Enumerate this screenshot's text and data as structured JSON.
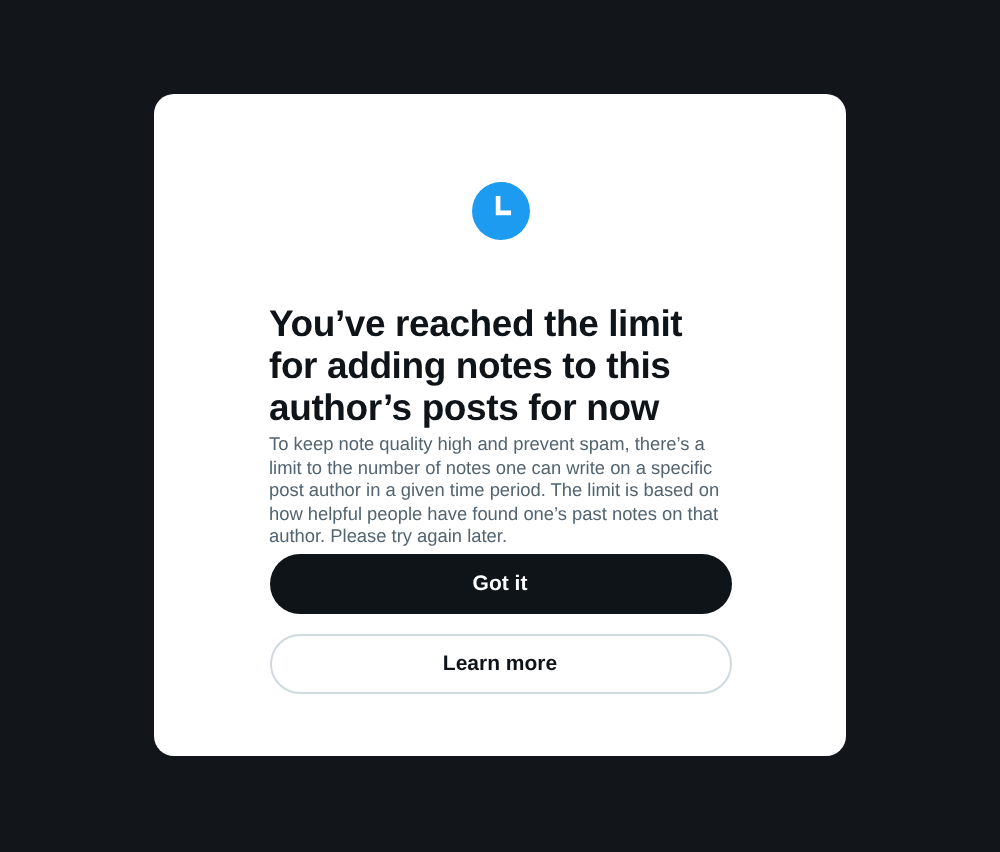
{
  "dialog": {
    "title": "You’ve reached the limit for adding notes to this author’s posts for now",
    "message": "To keep note quality high and prevent spam, there’s a limit to the number of notes one can write on a specific post author in a given time period. The limit is based on how helpful people have found one’s past notes on that author. Please try again later.",
    "buttons": [
      {
        "label": "Got it",
        "kind": "primary"
      },
      {
        "label": "Learn more",
        "kind": "secondary"
      }
    ]
  }
}
